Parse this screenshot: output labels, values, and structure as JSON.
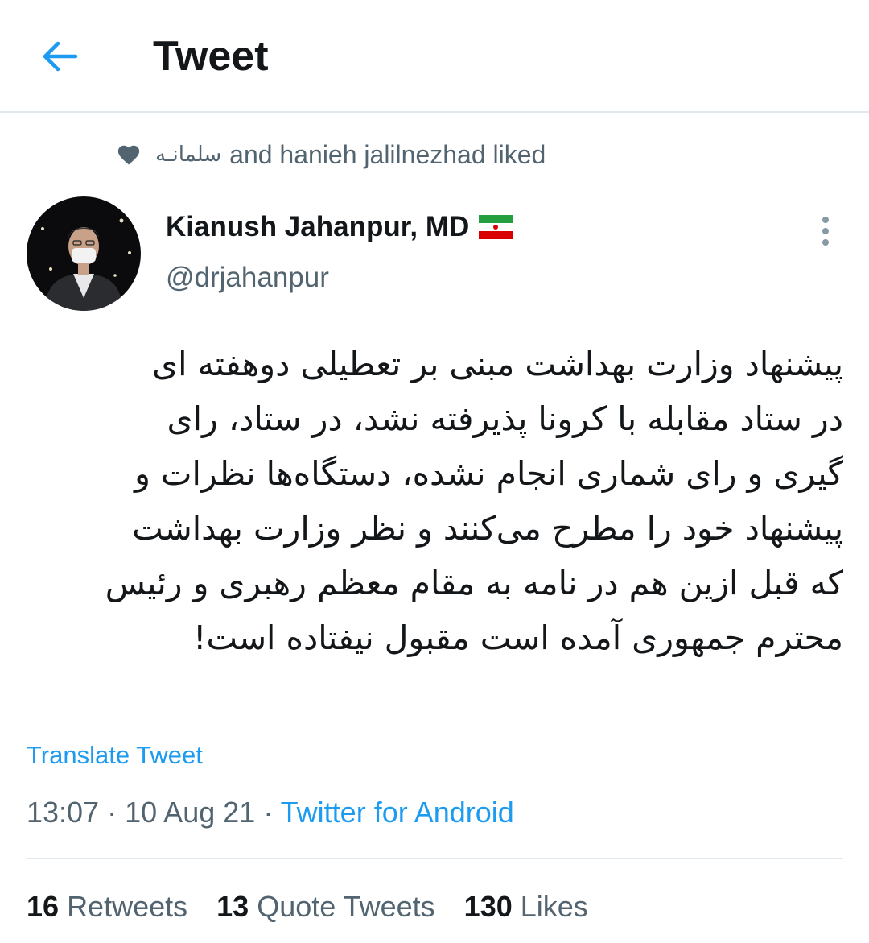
{
  "header": {
    "title": "Tweet"
  },
  "social_context": {
    "name_persian": "سلمانـه",
    "text": "and hanieh jalilnezhad liked"
  },
  "author": {
    "name": "Kianush Jahanpur, MD",
    "handle": "@drjahanpur"
  },
  "tweet": {
    "lines": [
      "پیشنهاد وزارت بهداشت مبنی بر تعطیلی دوهفته ای",
      "در ستاد مقابله با کرونا پذیرفته نشد، در ستاد، رای",
      "گیری و رای شماری انجام نشده، دستگاه‌ها نظرات و",
      "پیشنهاد خود را مطرح می‌کنند و نظر وزارت بهداشت",
      "که قبل ازین هم در نامه به مقام معظم رهبری و رئیس",
      "محترم جمهوری آمده است مقبول نیفتاده است!"
    ],
    "translate_label": "Translate Tweet",
    "time": "13:07",
    "date": "10 Aug 21",
    "separator": "·",
    "source": "Twitter for Android"
  },
  "stats": [
    {
      "count": "16",
      "label": "Retweets"
    },
    {
      "count": "13",
      "label": "Quote Tweets"
    },
    {
      "count": "130",
      "label": "Likes"
    }
  ],
  "colors": {
    "accent": "#1d9bf0",
    "secondary_text": "#536471",
    "divider": "#e1e8ed"
  },
  "icons": {
    "back": "arrow-left-icon",
    "heart": "heart-icon",
    "flag": "iran-flag-icon",
    "more": "more-vertical-icon"
  }
}
